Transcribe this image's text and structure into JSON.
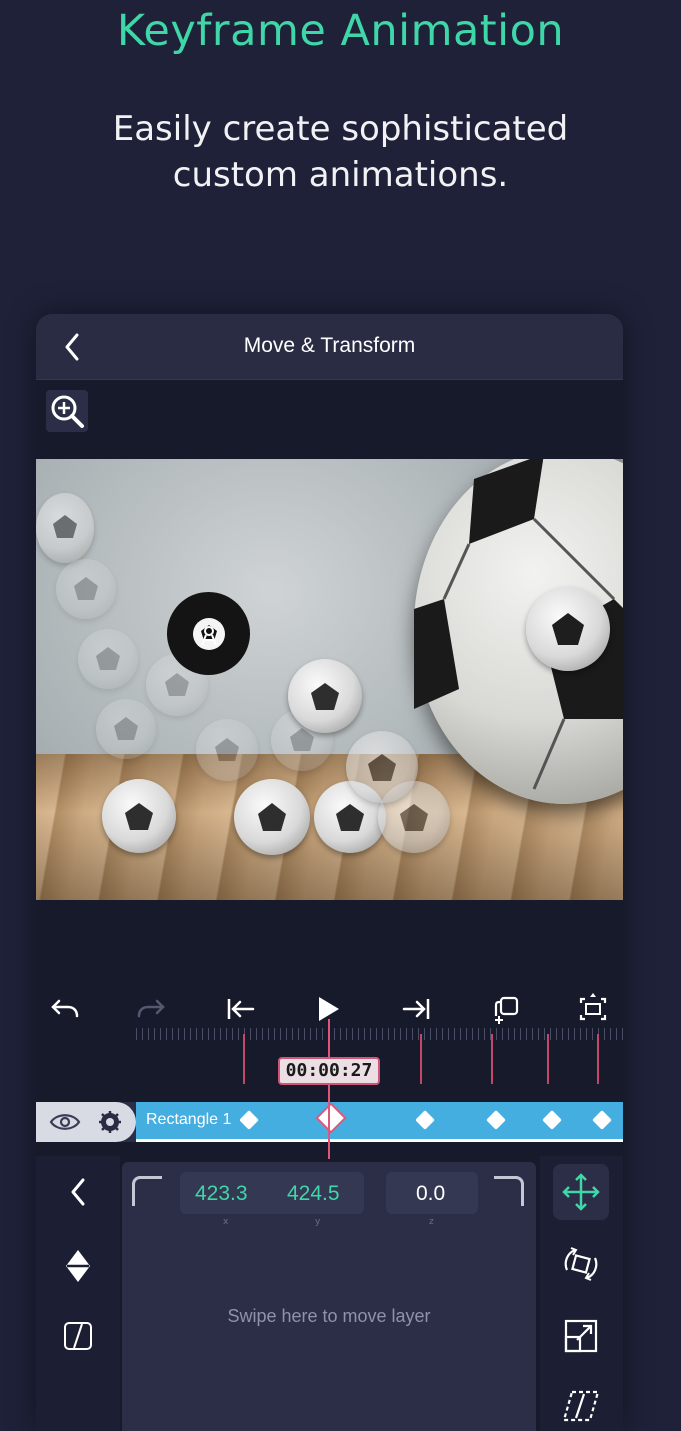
{
  "promo": {
    "title": "Keyframe Animation",
    "subtitle": "Easily create sophisticated custom animations."
  },
  "nav": {
    "title": "Move & Transform",
    "back_icon": "chevron-left-icon"
  },
  "toolbar": {
    "zoom_icon": "zoom-in-icon"
  },
  "transport": {
    "undo_icon": "undo-icon",
    "redo_icon": "redo-icon",
    "prev_icon": "skip-to-start-icon",
    "play_icon": "play-icon",
    "next_icon": "skip-to-end-icon",
    "copy_icon": "copy-add-icon",
    "crop_icon": "crop-fullscreen-icon"
  },
  "timeline": {
    "current_time": "00:00:27",
    "layer_name": "Rectangle 1",
    "colors": {
      "clip": "#45aee0",
      "playhead": "#e0557a"
    }
  },
  "transform": {
    "x_value": "423.3",
    "y_value": "424.5",
    "z_value": "0.0",
    "x_label": "x",
    "y_label": "y",
    "z_label": "z",
    "swipe_hint": "Swipe here to move layer"
  },
  "theme": {
    "accent": "#3fd6a8",
    "background": "#1f2139"
  }
}
